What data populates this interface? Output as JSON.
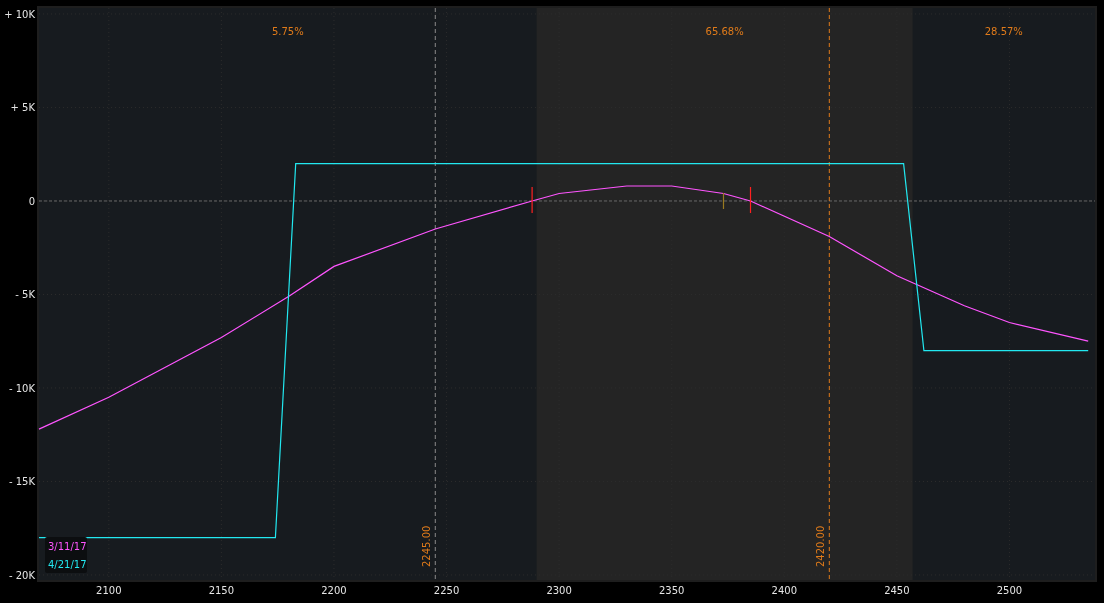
{
  "chart_data": {
    "type": "line",
    "grid": true,
    "xlim": [
      2069,
      2538
    ],
    "ylim": [
      -20270,
      10320
    ],
    "xticks": [
      2100,
      2150,
      2200,
      2250,
      2300,
      2350,
      2400,
      2450,
      2500
    ],
    "yticks": [
      {
        "value": 10000,
        "label": "+ 10K"
      },
      {
        "value": 5000,
        "label": "+ 5K"
      },
      {
        "value": 0,
        "label": "0"
      },
      {
        "value": -5000,
        "label": "- 5K"
      },
      {
        "value": -10000,
        "label": "- 10K"
      },
      {
        "value": -15000,
        "label": "- 15K"
      },
      {
        "value": -20000,
        "label": "- 20K"
      }
    ],
    "x": [
      2069,
      2100,
      2150,
      2180,
      2200,
      2245,
      2288,
      2300,
      2330,
      2350,
      2373,
      2385,
      2420,
      2450,
      2480,
      2500,
      2535
    ],
    "series": [
      {
        "name": "3/11/17",
        "color": "#ff55ff",
        "values": [
          -12200,
          -10500,
          -7300,
          -5100,
          -3500,
          -1500,
          0,
          400,
          800,
          800,
          400,
          0,
          -1900,
          -4000,
          -5600,
          -6500,
          -7500
        ]
      },
      {
        "name": "4/21/17",
        "color": "#22e8f0",
        "x": [
          2069,
          2174,
          2183,
          2453,
          2462,
          2535
        ],
        "values": [
          -18000,
          -18000,
          2000,
          2000,
          -8000,
          -8000
        ]
      }
    ],
    "bands": [
      {
        "axis": "x",
        "from": 2290,
        "to": 2457,
        "color": "#242424"
      }
    ],
    "ref_lines": [
      {
        "axis": "y",
        "value": 0,
        "color": "#666666"
      },
      {
        "axis": "x",
        "value": 2245,
        "label": "2245.00",
        "color": "#8a8a8a"
      },
      {
        "axis": "x",
        "value": 2420,
        "label": "2420.00",
        "color": "#e07b1a"
      }
    ],
    "annotations": [
      "5.75%",
      "65.68%",
      "28.57%"
    ]
  }
}
